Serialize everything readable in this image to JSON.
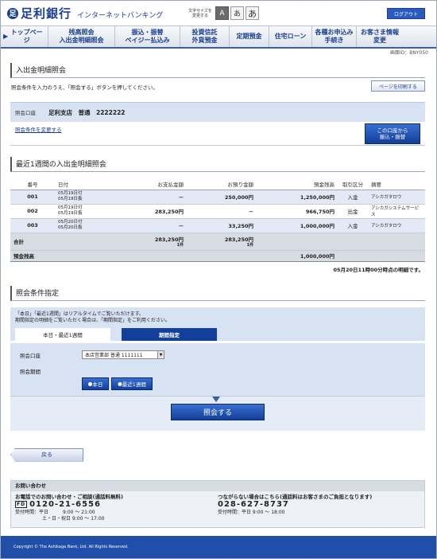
{
  "header": {
    "logo_mark": "足",
    "bank_name": "足利銀行",
    "service_name": "インターネットバンキング",
    "fontsize_label": "文字サイズを変更する",
    "fontsize_buttons": [
      "A",
      "あ",
      "あ"
    ],
    "logout_label": "ログアウト"
  },
  "nav": [
    "トップページ",
    "残高照会\n入出金明細照会",
    "振込・振替\nペイジー払込み",
    "投資信託\n外貨預金",
    "定期預金",
    "住宅ローン",
    "各種お申込み\n手続き",
    "お客さま情報\n変更"
  ],
  "screen_id": "画面ID：BNY050",
  "page_title": "入出金明細照会",
  "intro_text": "照会条件を入力のうえ、「照会する」ボタンを押してください。",
  "print_button": "ページを印刷する",
  "account": {
    "label": "照会口座",
    "value": "足利支店　普通　2222222",
    "change_link": "照会条件を変更する",
    "transfer_button": "この口座から\n振込・振替"
  },
  "tx_title": "最近1週間の入出金明細照会",
  "tx_headers": [
    "番号",
    "日付",
    "お支払金額",
    "お預り金額",
    "預金残高",
    "取引区分",
    "摘要"
  ],
  "transactions": [
    {
      "no": "001",
      "date1": "05月19日付",
      "date2": "05月19日扱",
      "payment": "－",
      "deposit": "250,000円",
      "balance": "1,250,000円",
      "kind": "入金",
      "memo": "アシカガタロウ"
    },
    {
      "no": "002",
      "date1": "05月19日付",
      "date2": "05月19日扱",
      "payment": "283,250円",
      "deposit": "－",
      "balance": "966,750円",
      "kind": "出金",
      "memo": "アシカガシステムサービス"
    },
    {
      "no": "003",
      "date1": "05月20日付",
      "date2": "05月20日扱",
      "payment": "－",
      "deposit": "33,250円",
      "balance": "1,000,000円",
      "kind": "入金",
      "memo": "アシカガタロウ"
    }
  ],
  "totals": {
    "label": "合計",
    "payment": "283,250円",
    "payment_count": "1件",
    "deposit": "283,250円",
    "deposit_count": "1件"
  },
  "balance_row": {
    "label": "預金残高",
    "value": "1,000,000円"
  },
  "as_of": "05月20日11時00分時点の明細です。",
  "cond_title": "照会条件指定",
  "cond_note": [
    "「本日」「最近1週間」はリアルタイムでご覧いただけます。",
    "期間指定の明細をご覧いただく場合は、「期間指定」をご利用ください。"
  ],
  "tabs": {
    "active": "本日・最近1週間",
    "inactive": "期間指定"
  },
  "cond_account_label": "照会口座",
  "cond_account_value": "本店営業部 普通 1111111",
  "cond_period_label": "照会期間",
  "period_buttons": [
    "本日",
    "最近1週間"
  ],
  "submit_button": "照会する",
  "back_button": "戻る",
  "contact": {
    "title": "お問い合わせ",
    "left_heading": "お電話でのお問い合わせ・ご相談(通話料無料)",
    "left_phone": "0120-21-6556",
    "left_fd": "FD",
    "left_hours1": "受付時間：平日　　　9:00 ～ 21:00",
    "left_hours2": "土・日・祝日 9:00 ～ 17:00",
    "right_heading": "つながらない場合はこちら(通話料はお客さまのご負担となります)",
    "right_phone": "028-627-8737",
    "right_hours": "受付時間：平日 9:00 ～ 18:00"
  },
  "copyright": "Copyright © The Ashikaga Bank, Ltd. All Rights Reserved."
}
